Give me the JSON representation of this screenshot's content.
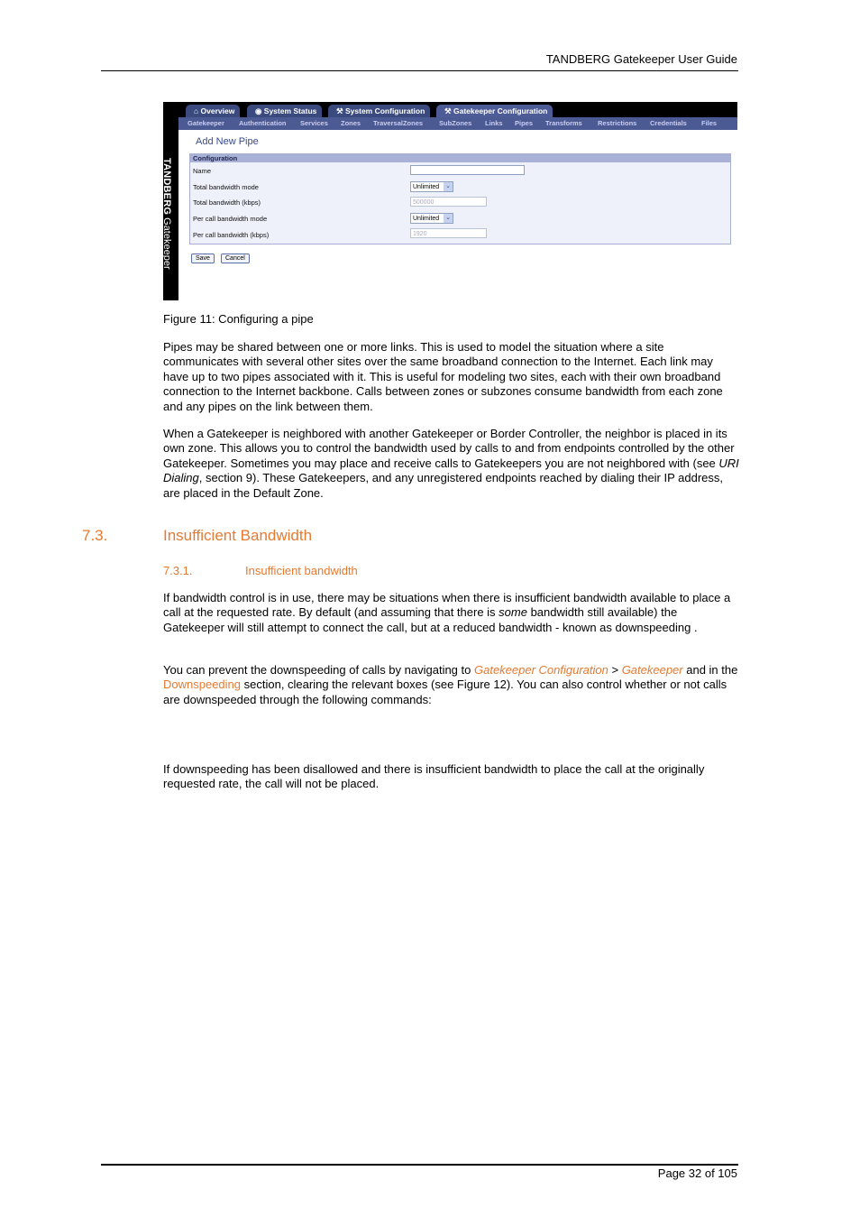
{
  "header": {
    "title": "TANDBERG Gatekeeper User Guide"
  },
  "footer": {
    "page": "Page 32 of 105"
  },
  "figure": {
    "brand": {
      "bold": "TANDBERG",
      "normal": "Gatekeeper"
    },
    "tabs": [
      {
        "label": "Overview",
        "icon": "home-icon"
      },
      {
        "label": "System Status",
        "icon": "status-icon"
      },
      {
        "label": "System Configuration",
        "icon": "wrench-icon"
      },
      {
        "label": "Gatekeeper Configuration",
        "icon": "wrench-icon",
        "active": true
      }
    ],
    "subnav": [
      "Gatekeeper",
      "Authentication",
      "Services",
      "Zones",
      "TraversalZones",
      "SubZones",
      "Links",
      "Pipes",
      "Transforms",
      "Restrictions",
      "Credentials",
      "Files"
    ],
    "page_title": "Add New Pipe",
    "section_title": "Configuration",
    "fields": [
      {
        "label": "Name",
        "type": "text",
        "value": ""
      },
      {
        "label": "Total bandwidth mode",
        "type": "select",
        "value": "Unlimited"
      },
      {
        "label": "Total bandwidth (kbps)",
        "type": "text",
        "value": "500000",
        "disabled": true
      },
      {
        "label": "Per call bandwidth mode",
        "type": "select",
        "value": "Unlimited"
      },
      {
        "label": "Per call bandwidth (kbps)",
        "type": "text",
        "value": "1920",
        "disabled": true
      }
    ],
    "buttons": {
      "save": "Save",
      "cancel": "Cancel"
    },
    "caption": "Figure 11: Configuring a pipe"
  },
  "paragraphs": {
    "p1": "Pipes may be shared between one or more links. This is used to model the situation where a site communicates with several other sites over the same broadband connection to the Internet. Each link may have up to two pipes associated with it. This is useful for modeling two sites, each with their own broadband connection to the Internet backbone. Calls between zones or subzones consume bandwidth from each zone and any pipes on the link between them.",
    "p2a": "When a Gatekeeper is neighbored with another Gatekeeper or Border Controller, the neighbor is placed in its own zone. This allows you to control the bandwidth used by calls to and from endpoints controlled by the other Gatekeeper. Sometimes you may place and receive calls to Gatekeepers you are not neighbored with (see ",
    "p2em": "URI Dialing",
    "p2b": ", section 9). These Gatekeepers, and any unregistered endpoints reached by dialing their IP address, are placed in the Default Zone.",
    "p3a": "If bandwidth control is in use, there may be situations when there is insufficient bandwidth available to place a call at the requested rate.  By default (and assuming that there is ",
    "p3em": "some",
    "p3b": " bandwidth still available) the Gatekeeper will still attempt to connect the call, but at a reduced bandwidth - known as downspeeding .",
    "p4a": "You can prevent the downspeeding of calls by navigating to ",
    "p4link1": "Gatekeeper Configuration",
    "p4sep": " > ",
    "p4link2": "Gatekeeper",
    "p4b": " and in the ",
    "p4link3": "Downspeeding",
    "p4c": " section, clearing the relevant boxes (see Figure 12).  You can also control whether or not calls are downspeeded through the following commands:",
    "p5": "If downspeeding has been disallowed and there is insufficient bandwidth to place the call at the originally requested rate, the call will not be placed."
  },
  "headings": {
    "h2_num": "7.3.",
    "h2_text": "Insufficient Bandwidth",
    "h3_num": "7.3.1.",
    "h3_text": "Insufficient bandwidth"
  },
  "colors": {
    "heading": "#e57a30",
    "nav": "#4c5a93"
  }
}
